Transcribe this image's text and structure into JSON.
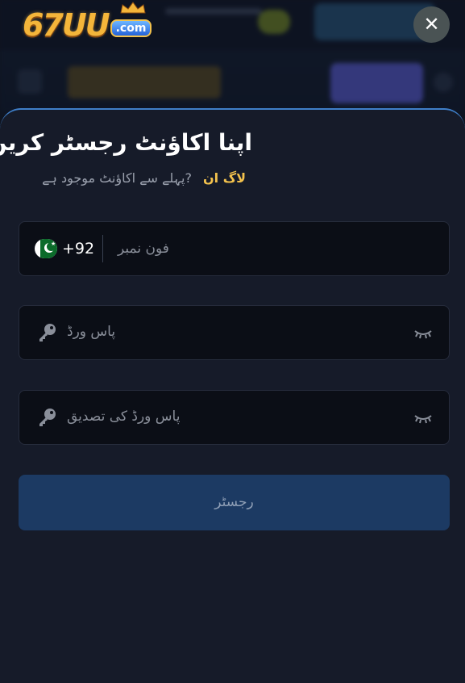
{
  "header": {
    "logo_text": "67UU",
    "logo_suffix": ".com",
    "close_label": "✕"
  },
  "register": {
    "title": "اپنا اکاؤنٹ رجسٹر کریں",
    "question": "?پہلے سے اکاؤنٹ موجود ہے",
    "login_link": "لاگ ان",
    "country_code": "+92",
    "phone_placeholder": "فون نمبر",
    "password_placeholder": "پاس ورڈ",
    "confirm_placeholder": "پاس ورڈ کی تصدیق",
    "submit_label": "رجسٹر"
  },
  "colors": {
    "accent": "#f3c24d",
    "sheet": "#161b29",
    "button": "#1c3a63"
  }
}
